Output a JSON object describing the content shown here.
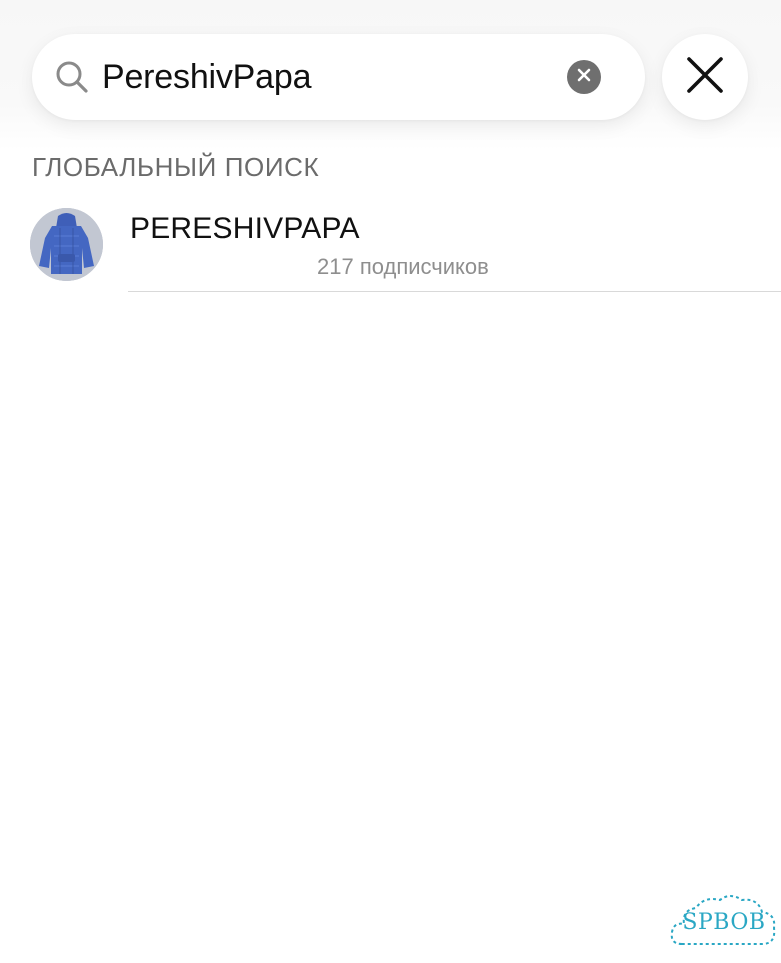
{
  "search": {
    "query": "PereshivPapa",
    "search_icon": "search-icon",
    "clear_icon": "clear-circle-icon",
    "close_icon": "close-icon"
  },
  "sections": {
    "global_search_title": "ГЛОБАЛЬНЫЙ ПОИСК"
  },
  "results": [
    {
      "name": "PERESHIVPAPA",
      "subscribers": "217 подписчиков",
      "avatar": "hoodie-avatar"
    }
  ],
  "watermark": {
    "text": "SPBOB"
  },
  "colors": {
    "text_primary": "#111111",
    "text_secondary": "#8e8e8e",
    "section_title": "#6b6b6b",
    "clear_button": "#6f6f6f",
    "avatar_hoodie": "#3f5fb8",
    "watermark": "#2aa7c4"
  }
}
